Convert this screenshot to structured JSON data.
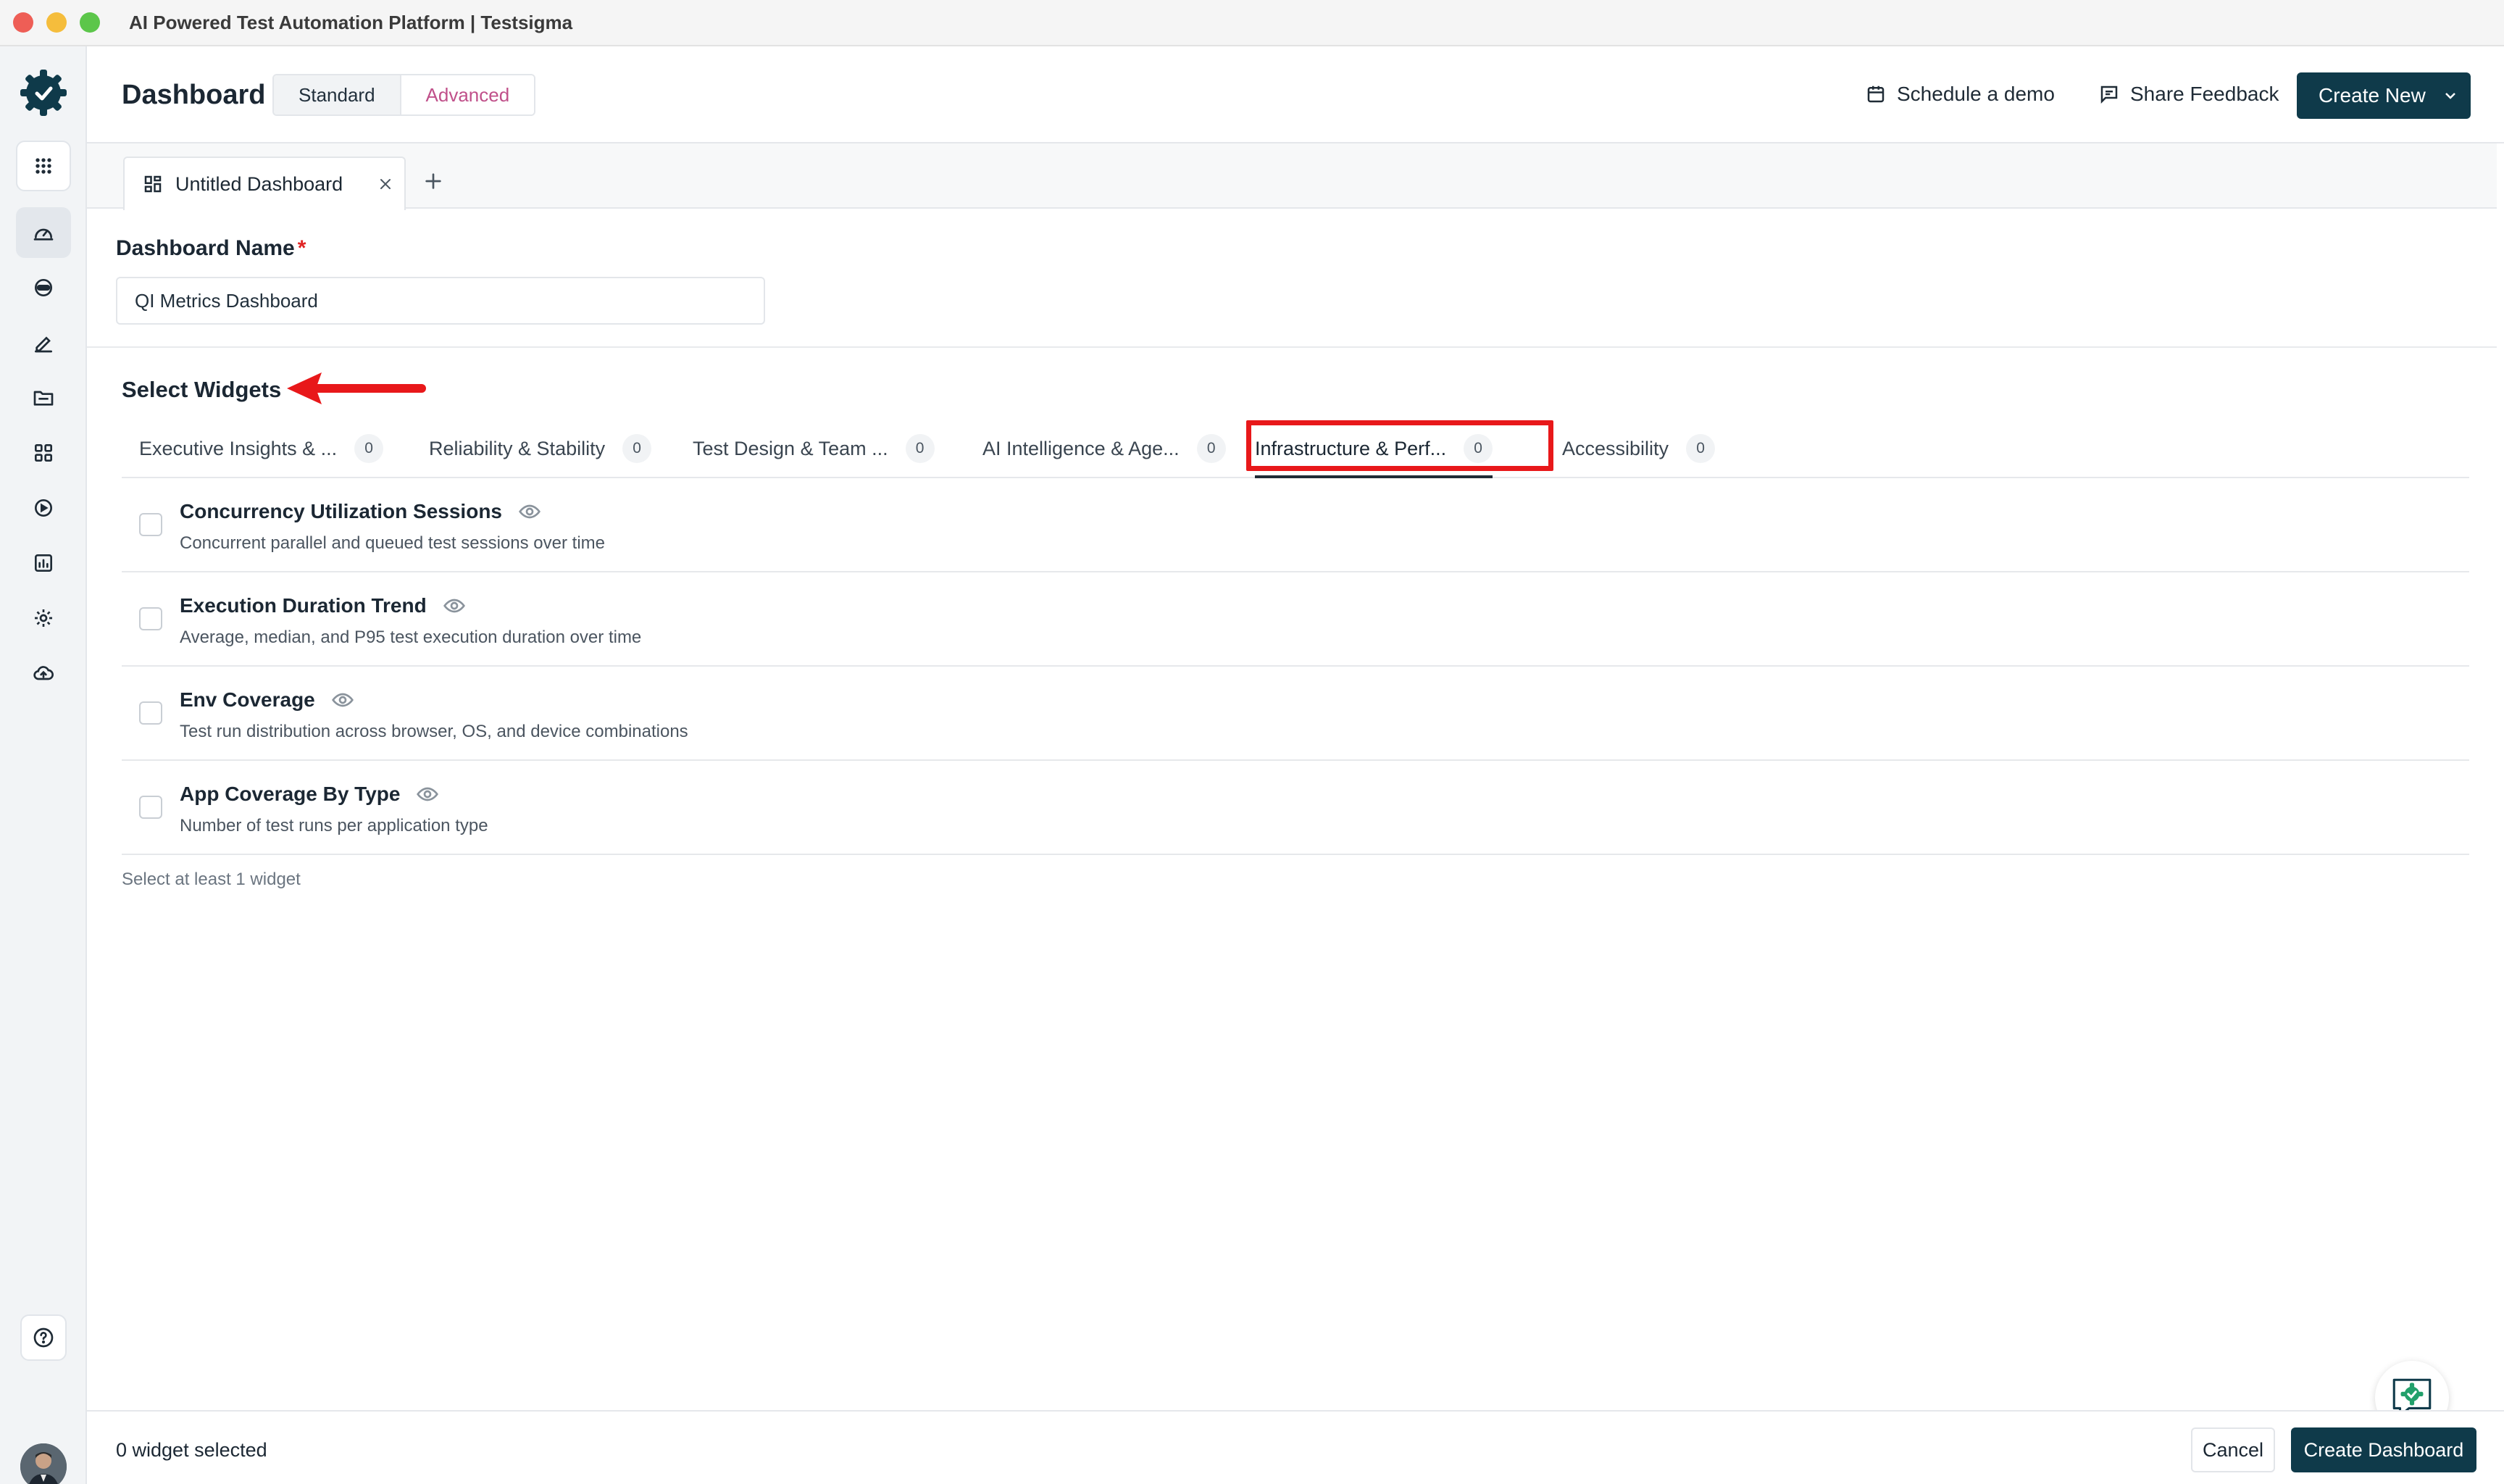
{
  "window": {
    "title": "AI Powered Test Automation Platform | Testsigma"
  },
  "sidebar": {
    "icons": [
      "apps-grid-icon",
      "dashboard-gauge-icon",
      "agent-icon",
      "pen-icon",
      "folder-icon",
      "widgets-icon",
      "play-circle-icon",
      "bar-chart-icon",
      "gear-icon",
      "cloud-upload-icon",
      "help-icon"
    ],
    "active": "dashboard-gauge-icon"
  },
  "header": {
    "title": "Dashboard",
    "mode_options": [
      "Standard",
      "Advanced"
    ],
    "selected_mode": "Advanced",
    "schedule_demo": "Schedule a demo",
    "share_feedback": "Share Feedback",
    "create_new": "Create New"
  },
  "tabs": {
    "dashboard_tab": "Untitled Dashboard"
  },
  "form": {
    "name_label": "Dashboard Name",
    "required_mark": "*",
    "name_value": "QI Metrics Dashboard"
  },
  "widgets": {
    "section_title": "Select Widgets",
    "categories": [
      {
        "label": "Executive Insights & ...",
        "count": "0"
      },
      {
        "label": "Reliability & Stability",
        "count": "0"
      },
      {
        "label": "Test Design & Team ...",
        "count": "0"
      },
      {
        "label": "AI Intelligence & Age...",
        "count": "0"
      },
      {
        "label": "Infrastructure & Perf...",
        "count": "0"
      },
      {
        "label": "Accessibility",
        "count": "0"
      }
    ],
    "active_category": "Infrastructure & Perf...",
    "items": [
      {
        "name": "Concurrency Utilization Sessions",
        "description": "Concurrent parallel and queued test sessions over time"
      },
      {
        "name": "Execution Duration Trend",
        "description": "Average, median, and P95 test execution duration over time"
      },
      {
        "name": "Env Coverage",
        "description": "Test run distribution across browser, OS, and device combinations"
      },
      {
        "name": "App Coverage By Type",
        "description": "Number of test runs per application type"
      }
    ],
    "hint": "Select at least 1 widget"
  },
  "footer": {
    "selected_count": "0 widget selected",
    "cancel": "Cancel",
    "create": "Create Dashboard"
  },
  "colors": {
    "primary": "#0f3a4a",
    "accent_pink": "#c0508a",
    "annotation_red": "#e8181a"
  }
}
